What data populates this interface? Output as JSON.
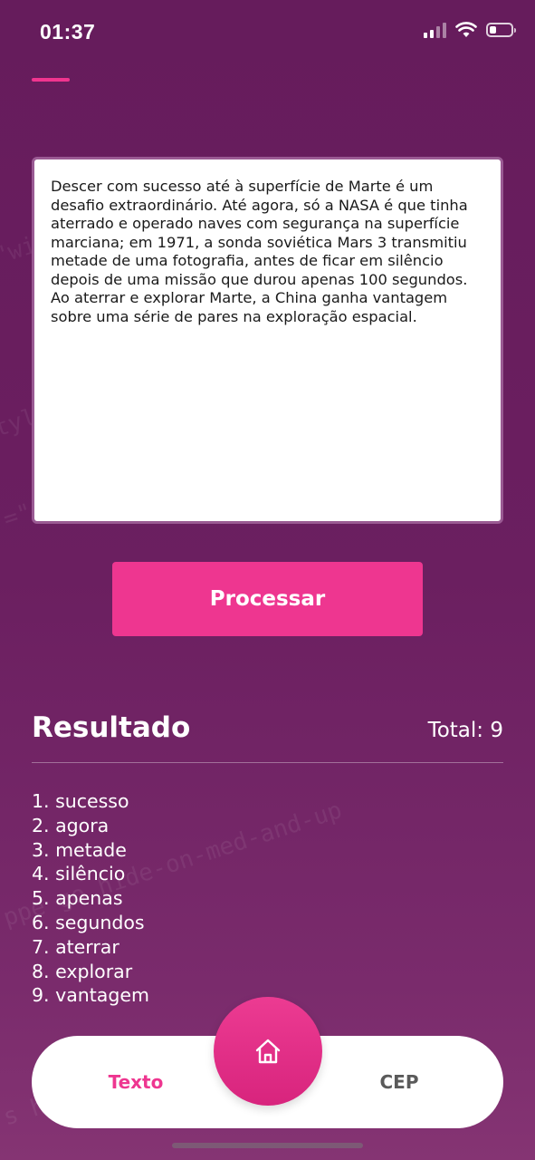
{
  "status_bar": {
    "time": "01:37",
    "battery_level": 0.3
  },
  "input": {
    "text": "Descer com sucesso até à superfície de Marte é um desafio extraordinário. Até agora, só a NASA é que tinha aterrado e operado naves com segurança na superfície marciana; em 1971, a sonda soviética Mars 3 transmitiu metade de uma fotografia, antes de ficar em silêncio depois de uma missão que durou apenas 100 segundos. Ao aterrar e explorar Marte, a China ganha vantagem sobre uma série de pares na exploração espacial."
  },
  "actions": {
    "process_label": "Processar"
  },
  "result": {
    "title": "Resultado",
    "total": "Total: 9",
    "items": [
      "1. sucesso",
      "2. agora",
      "3. metade",
      "4. silêncio",
      "5. apenas",
      "6. segundos",
      "7. aterrar",
      "8. explorar",
      "9. vantagem"
    ]
  },
  "tab_bar": {
    "left_label": "Texto",
    "right_label": "CEP",
    "center_icon": "home-icon"
  },
  "colors": {
    "background": "#6b1f60",
    "accent": "#ee3690",
    "tab_inactive": "#5a5a5a"
  }
}
